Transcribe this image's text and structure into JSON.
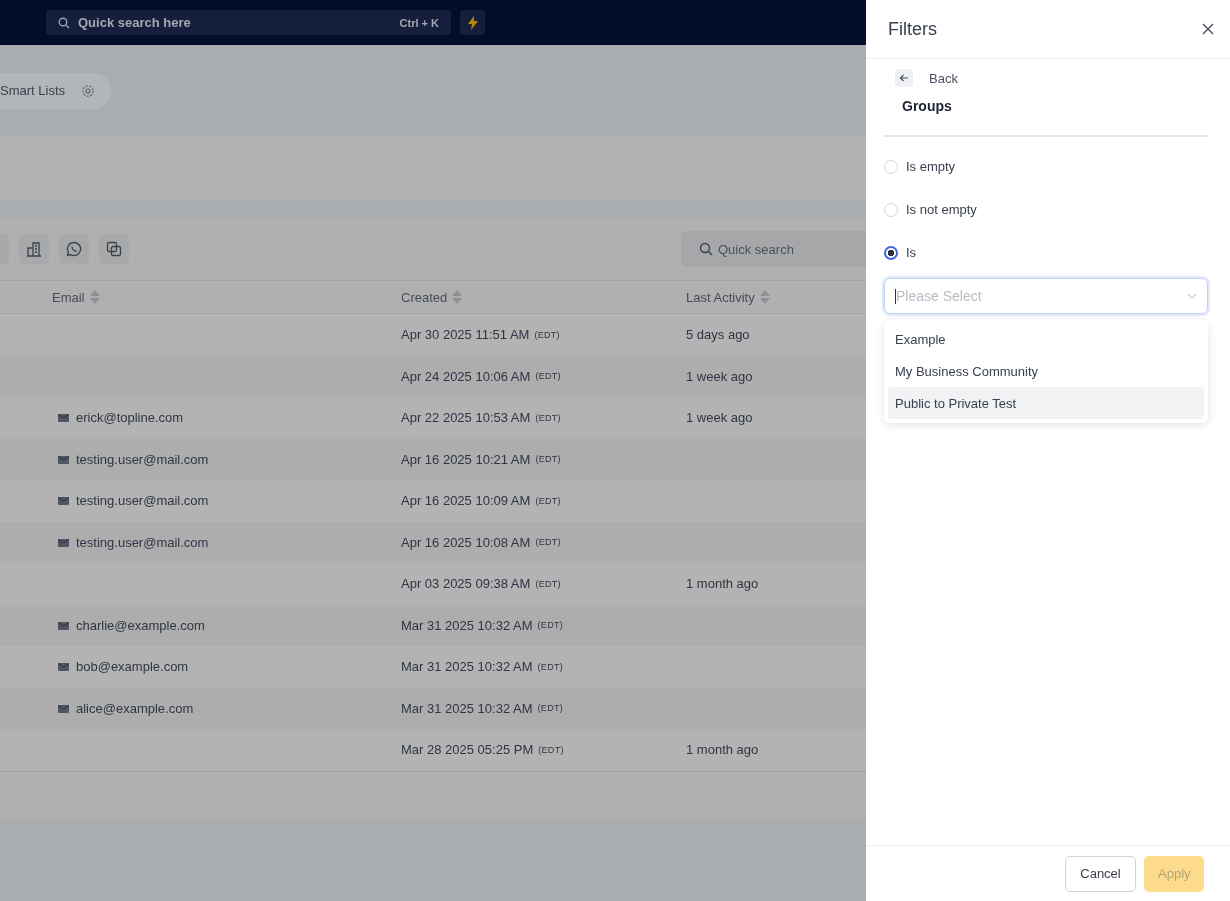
{
  "top_bar": {
    "search": {
      "placeholder": "Quick search here",
      "shortcut": "Ctrl + K"
    }
  },
  "smart_lists": {
    "label": "Smart Lists"
  },
  "toolbar": {
    "search": {
      "placeholder": "Quick search"
    }
  },
  "table": {
    "columns": [
      "Email",
      "Created",
      "Last Activity"
    ],
    "rows": [
      {
        "email": "",
        "created": "Apr 30 2025 11:51 AM",
        "timezone": "(EDT)",
        "last_activity": "5 days ago"
      },
      {
        "email": "",
        "created": "Apr 24 2025 10:06 AM",
        "timezone": "(EDT)",
        "last_activity": "1 week ago"
      },
      {
        "email": "erick@topline.com",
        "created": "Apr 22 2025 10:53 AM",
        "timezone": "(EDT)",
        "last_activity": "1 week ago"
      },
      {
        "email": "testing.user@mail.com",
        "created": "Apr 16 2025 10:21 AM",
        "timezone": "(EDT)",
        "last_activity": ""
      },
      {
        "email": "testing.user@mail.com",
        "created": "Apr 16 2025 10:09 AM",
        "timezone": "(EDT)",
        "last_activity": ""
      },
      {
        "email": "testing.user@mail.com",
        "created": "Apr 16 2025 10:08 AM",
        "timezone": "(EDT)",
        "last_activity": ""
      },
      {
        "email": "",
        "created": "Apr 03 2025 09:38 AM",
        "timezone": "(EDT)",
        "last_activity": "1 month ago"
      },
      {
        "email": "charlie@example.com",
        "created": "Mar 31 2025 10:32 AM",
        "timezone": "(EDT)",
        "last_activity": ""
      },
      {
        "email": "bob@example.com",
        "created": "Mar 31 2025 10:32 AM",
        "timezone": "(EDT)",
        "last_activity": ""
      },
      {
        "email": "alice@example.com",
        "created": "Mar 31 2025 10:32 AM",
        "timezone": "(EDT)",
        "last_activity": ""
      },
      {
        "email": "",
        "created": "Mar 28 2025 05:25 PM",
        "timezone": "(EDT)",
        "last_activity": "1 month ago"
      }
    ]
  },
  "filters_panel": {
    "title": "Filters",
    "back": "Back",
    "heading": "Groups",
    "options": [
      {
        "label": "Is empty",
        "selected": false
      },
      {
        "label": "Is not empty",
        "selected": false
      },
      {
        "label": "Is",
        "selected": true
      }
    ],
    "select": {
      "placeholder": "Please Select"
    },
    "dropdown": [
      {
        "label": "Example",
        "highlighted": false
      },
      {
        "label": "My Business Community",
        "highlighted": false
      },
      {
        "label": "Public to Private Test",
        "highlighted": true
      }
    ],
    "buttons": [
      {
        "label": "Cancel",
        "kind": "secondary",
        "disabled": false
      },
      {
        "label": "Apply",
        "kind": "primary",
        "disabled": true
      }
    ]
  }
}
